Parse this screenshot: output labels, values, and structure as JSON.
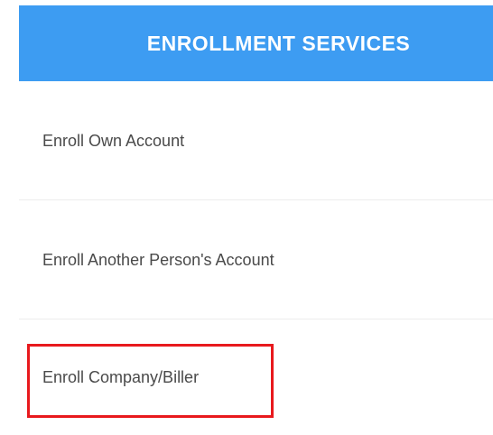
{
  "header": {
    "title": "ENROLLMENT SERVICES"
  },
  "menu": {
    "items": [
      {
        "label": "Enroll Own Account"
      },
      {
        "label": "Enroll Another Person's Account"
      },
      {
        "label": "Enroll Company/Biller"
      }
    ]
  },
  "colors": {
    "header_bg": "#3d9cf2",
    "header_text": "#ffffff",
    "item_text": "#4a4a4a",
    "highlight": "#e8191d"
  }
}
